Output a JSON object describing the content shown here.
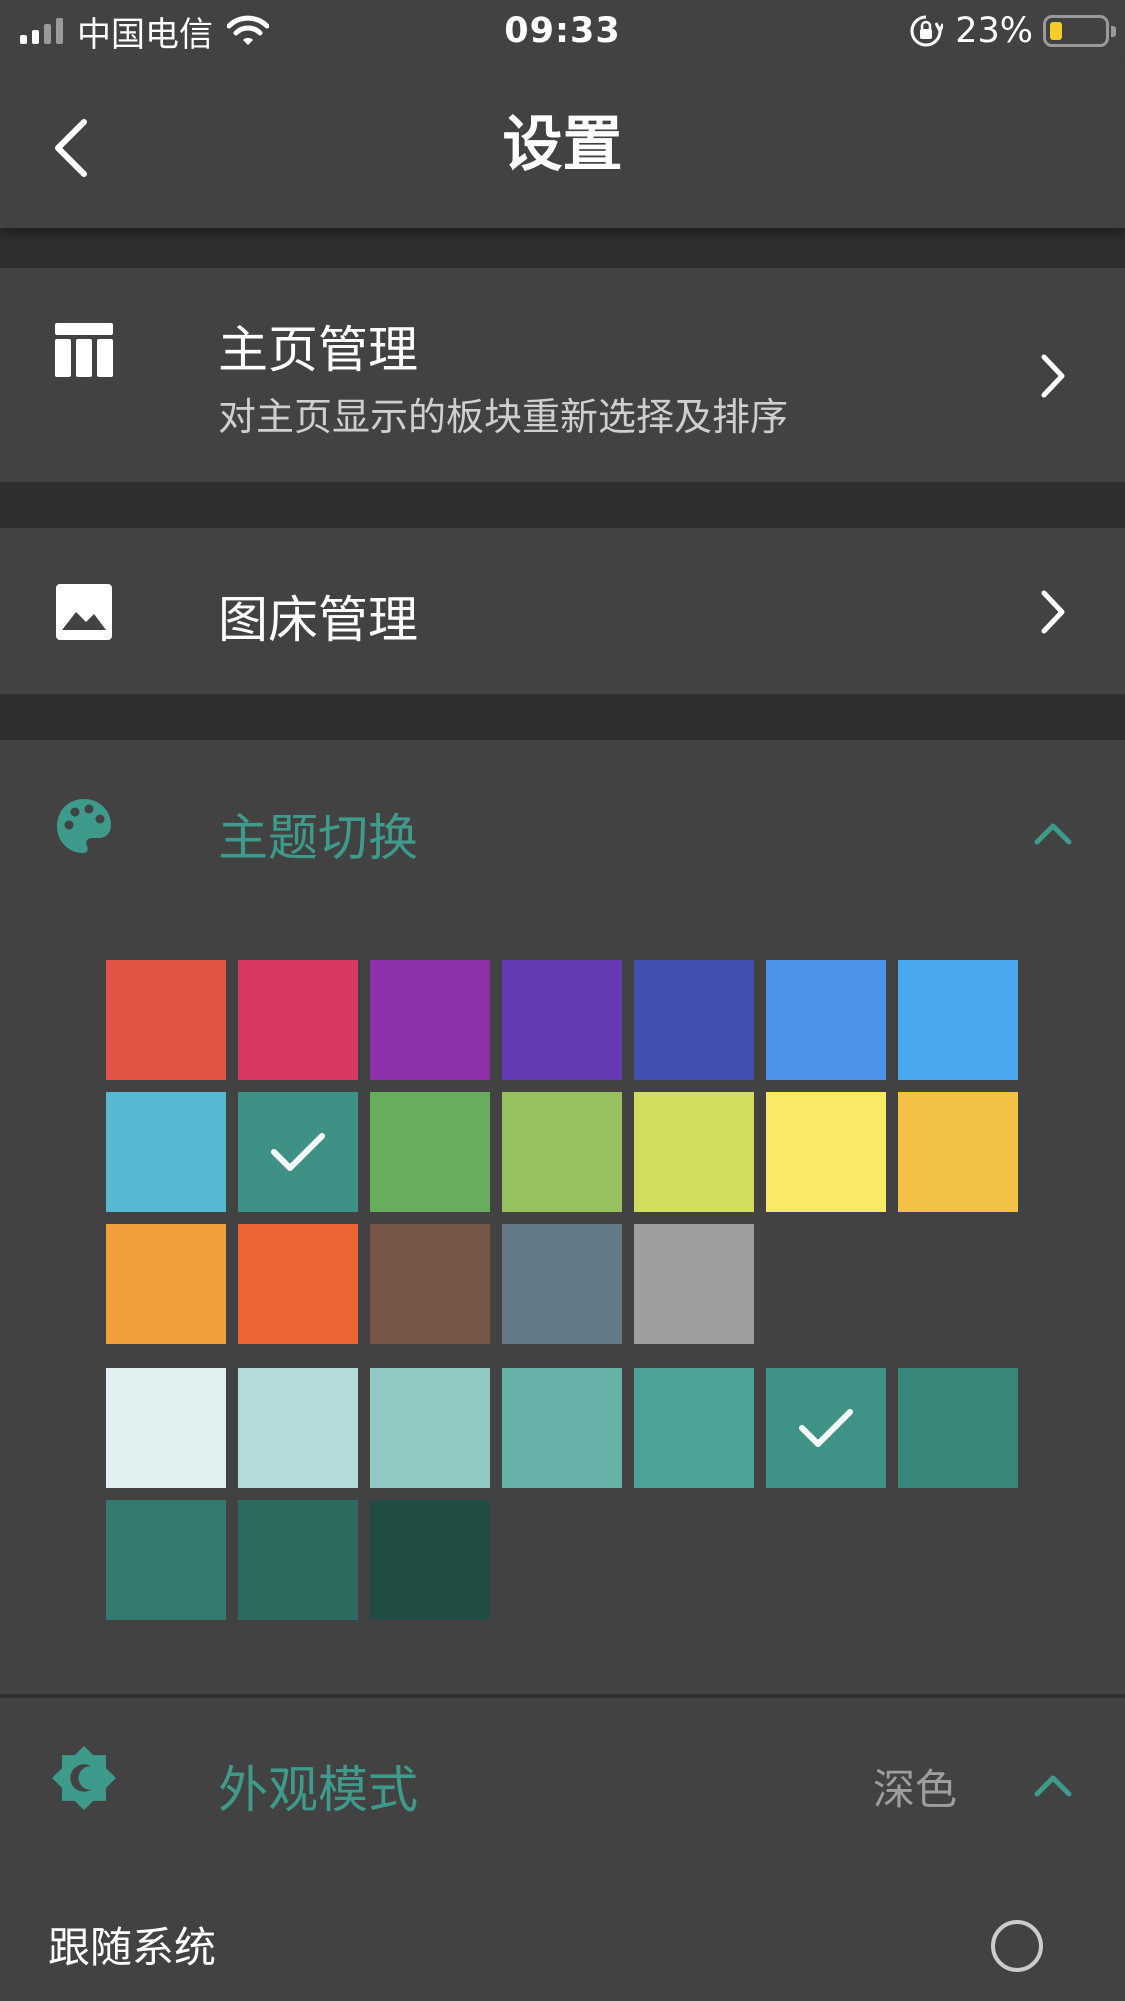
{
  "status_bar": {
    "carrier": "中国电信",
    "time": "09:33",
    "battery_percent_text": "23%",
    "battery_level": 0.23,
    "battery_fill_color": "#f4cd2a",
    "signal_bars_total": 4,
    "signal_bars_active": 2
  },
  "nav": {
    "title": "设置",
    "back_icon": "chevron-left-icon"
  },
  "home_management": {
    "icon": "table-columns-icon",
    "title": "主页管理",
    "subtitle": "对主页显示的板块重新选择及排序",
    "chevron_icon": "chevron-right-icon"
  },
  "image_host": {
    "icon": "image-icon",
    "title": "图床管理",
    "chevron_icon": "chevron-right-icon"
  },
  "theme": {
    "icon": "palette-icon",
    "title": "主题切换",
    "collapse_icon": "chevron-up-icon",
    "accent_color": "#3e9a8b",
    "primary_colors": [
      "#e25445",
      "#d83963",
      "#8e30aa",
      "#653bb4",
      "#4350b2",
      "#4b93e9",
      "#4aa8ee",
      "#56b9d2",
      "#3e9184",
      "#68ac5e",
      "#97c15e",
      "#d1dd5e",
      "#fae964",
      "#f3c143",
      "#f19f3a",
      "#ec6336",
      "#775549",
      "#637a86",
      "#9e9e9e"
    ],
    "primary_selected_index": 8,
    "shade_colors": [
      "#e0efef",
      "#b3dbda",
      "#90c9c4",
      "#67b0a8",
      "#4da398",
      "#3f9386",
      "#39877b",
      "#347a6f",
      "#2d6b60",
      "#204c43"
    ],
    "shade_selected_index": 5
  },
  "appearance": {
    "icon": "brightness-icon",
    "title": "外观模式",
    "value": "深色",
    "collapse_icon": "chevron-up-icon",
    "options": [
      {
        "label": "跟随系统",
        "selected": false
      }
    ]
  }
}
